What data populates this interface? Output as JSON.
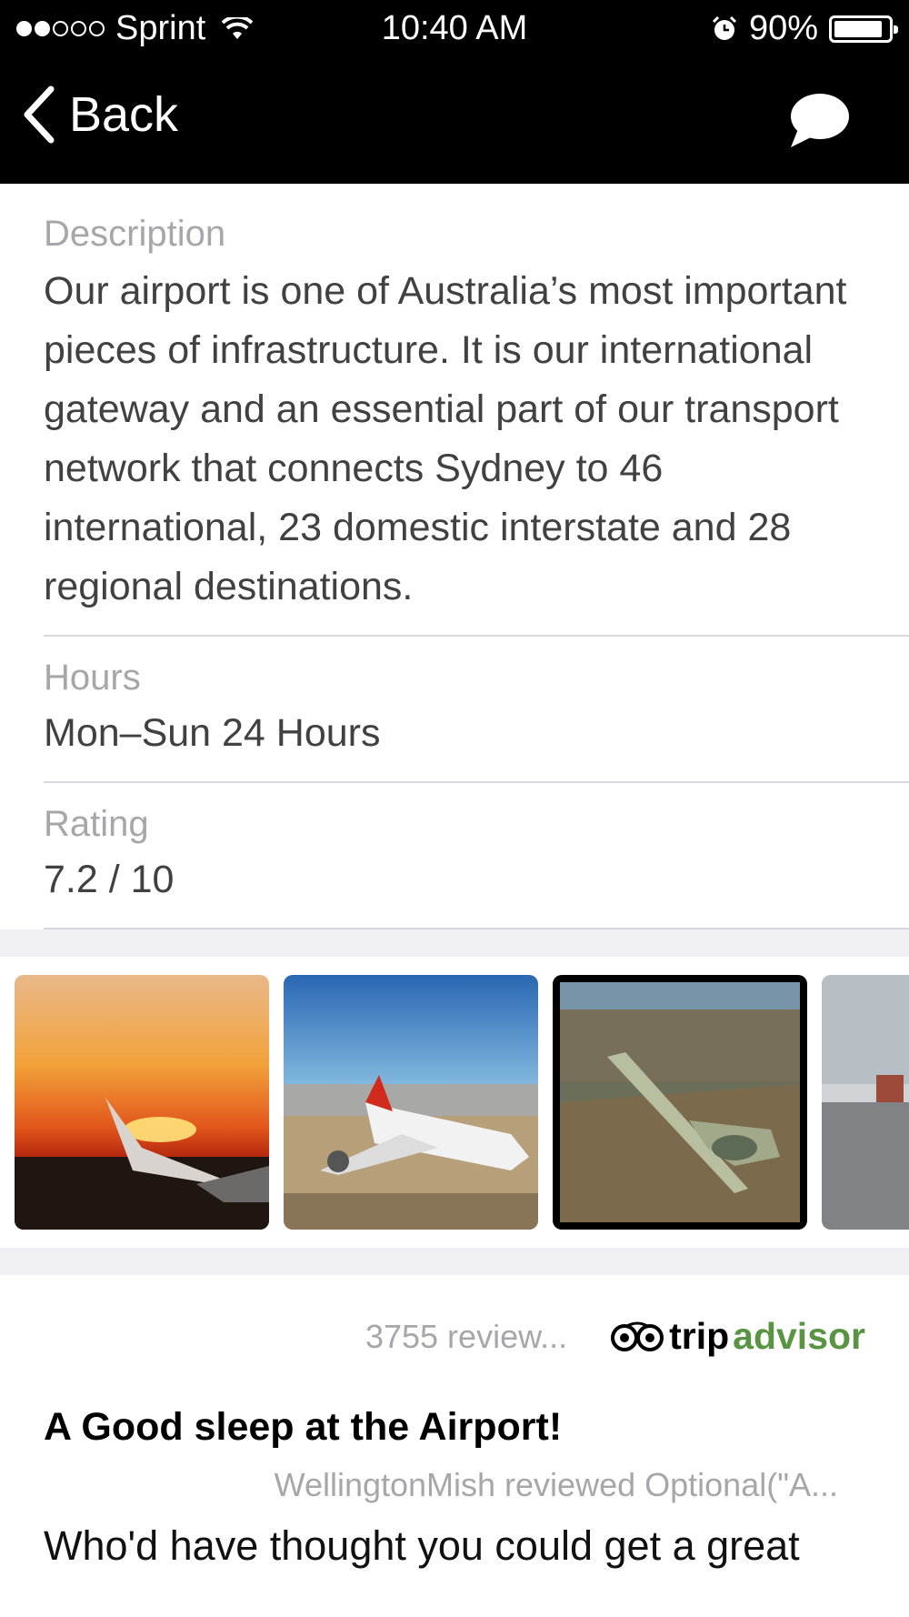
{
  "status_bar": {
    "carrier": "Sprint",
    "time": "10:40 AM",
    "battery": "90%",
    "battery_level": 0.9
  },
  "nav": {
    "back_label": "Back"
  },
  "details": {
    "description_label": "Description",
    "description": "Our airport is one of Australia’s most important pieces of infrastructure. It is our international gateway and an essential part of our transport network that connects Sydney to 46 international, 23 domestic interstate and 28 regional destinations.",
    "hours_label": "Hours",
    "hours": "Mon–Sun 24 Hours",
    "rating_label": "Rating",
    "rating": "7.2 / 10"
  },
  "reviews": {
    "count_text": "3755 review...",
    "brand_trip": "trip",
    "brand_advisor": "advisor",
    "title": "A Good sleep at the Airport!",
    "author_line": "WellingtonMish reviewed Optional(\"A...",
    "body_preview": "Who'd have thought you could get a great"
  }
}
